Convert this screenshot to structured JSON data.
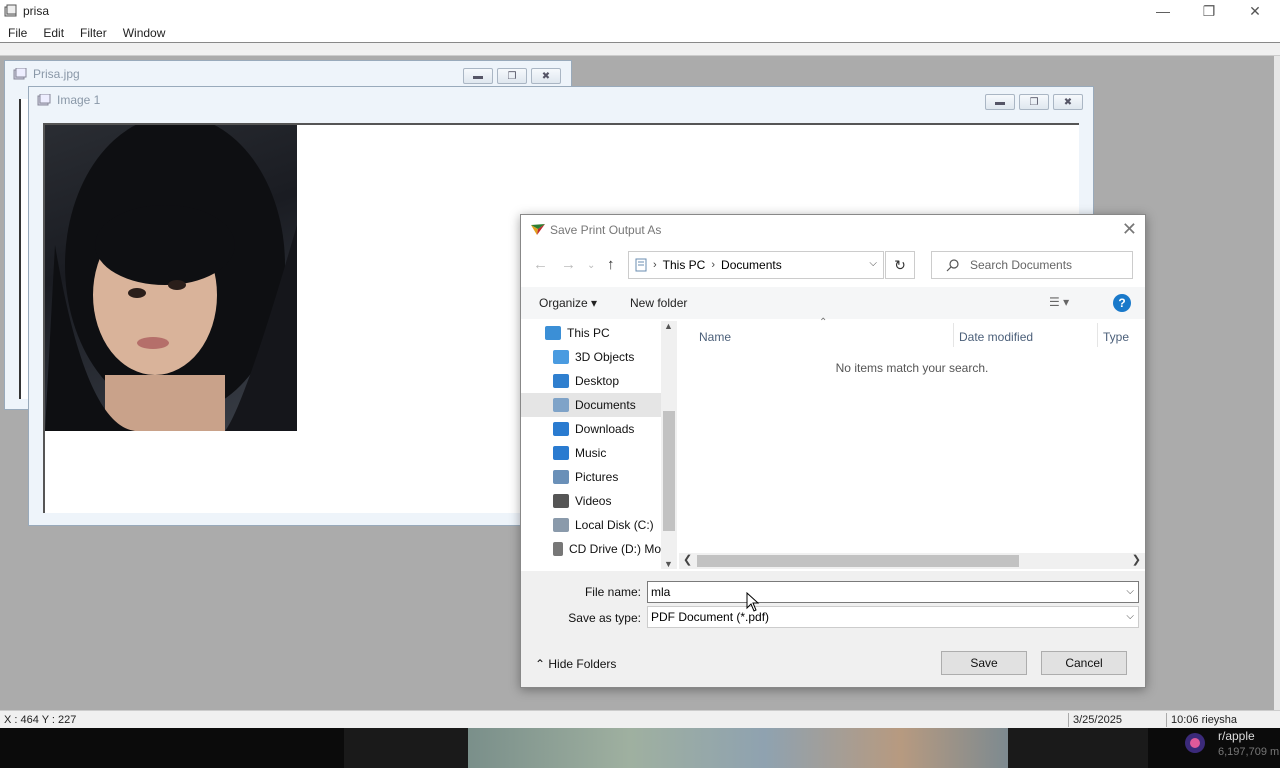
{
  "app": {
    "title": "prisa",
    "menu": [
      "File",
      "Edit",
      "Filter",
      "Window"
    ]
  },
  "windows": {
    "child1_title": "Prisa.jpg",
    "child2_title": "Image 1"
  },
  "dialog": {
    "title": "Save Print Output As",
    "breadcrumb": [
      "This PC",
      "Documents"
    ],
    "search_placeholder": "Search Documents",
    "organize_label": "Organize",
    "new_folder_label": "New folder",
    "nav_items": [
      {
        "label": "This PC",
        "icon": "pc-icon"
      },
      {
        "label": "3D Objects",
        "icon": "cube-icon"
      },
      {
        "label": "Desktop",
        "icon": "desktop-icon"
      },
      {
        "label": "Documents",
        "icon": "document-icon",
        "selected": true
      },
      {
        "label": "Downloads",
        "icon": "download-icon"
      },
      {
        "label": "Music",
        "icon": "music-icon"
      },
      {
        "label": "Pictures",
        "icon": "pictures-icon"
      },
      {
        "label": "Videos",
        "icon": "video-icon"
      },
      {
        "label": "Local Disk (C:)",
        "icon": "disk-icon"
      },
      {
        "label": "CD Drive (D:) Mo",
        "icon": "cd-icon"
      }
    ],
    "columns": [
      "Name",
      "Date modified",
      "Type"
    ],
    "empty_message": "No items match your search.",
    "file_name_label": "File name:",
    "file_name_value": "mla",
    "save_type_label": "Save as type:",
    "save_type_value": "PDF Document (*.pdf)",
    "hide_folders_label": "Hide Folders",
    "save_label": "Save",
    "cancel_label": "Cancel"
  },
  "status": {
    "coords": "X : 464 Y : 227",
    "date": "3/25/2025",
    "time_user": "10:06 rieysha"
  },
  "taskbar": {
    "notif_title": "r/apple",
    "notif_sub": "6,197,709 m"
  },
  "colors": {
    "accent": "#1979ca",
    "mdi_background": "#ababab",
    "selection": "#e5e5e5"
  }
}
